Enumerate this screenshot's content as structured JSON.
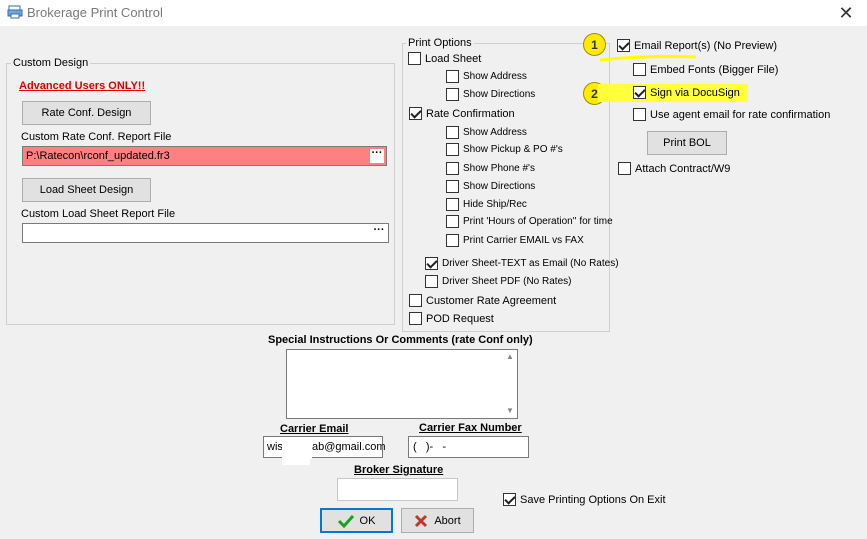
{
  "window": {
    "title": "Brokerage Print Control",
    "close_glyph": "✕"
  },
  "custom_design": {
    "legend": "Custom Design",
    "advanced_label": "Advanced Users ONLY!!",
    "rate_conf_button": "Rate Conf. Design",
    "rate_conf_report_label": "Custom Rate Conf. Report File",
    "rate_conf_report_value": "P:\\Ratecon\\rconf_updated.fr3",
    "load_sheet_button": "Load Sheet Design",
    "load_sheet_report_label": "Custom Load Sheet Report File",
    "load_sheet_report_value": "",
    "ellipsis": "···"
  },
  "print_options": {
    "legend": "Print Options",
    "load_sheet": {
      "label": "Load Sheet",
      "checked": false
    },
    "load_sheet_opts": [
      {
        "label": "Show Address",
        "checked": false
      },
      {
        "label": "Show Directions",
        "checked": false
      }
    ],
    "rate_confirmation": {
      "label": "Rate Confirmation",
      "checked": true
    },
    "rate_conf_opts": [
      {
        "label": "Show Address",
        "checked": false
      },
      {
        "label": "Show Pickup & PO #'s",
        "checked": false
      },
      {
        "label": "Show Phone #'s",
        "checked": false
      },
      {
        "label": "Show Directions",
        "checked": false
      },
      {
        "label": "Hide Ship/Rec",
        "checked": false
      },
      {
        "label": "Print 'Hours of Operation'' for time",
        "checked": false
      },
      {
        "label": "Print Carrier EMAIL vs FAX",
        "checked": false
      }
    ],
    "driver_sheet_text": {
      "label": "Driver Sheet-TEXT as Email (No Rates)",
      "checked": true
    },
    "driver_sheet_pdf": {
      "label": "Driver Sheet PDF (No Rates)",
      "checked": false
    },
    "customer_rate_agreement": {
      "label": "Customer Rate Agreement",
      "checked": false
    },
    "pod_request": {
      "label": "POD Request",
      "checked": false
    }
  },
  "right_options": {
    "badge1": "1",
    "badge2": "2",
    "email_reports": {
      "label": "Email Report(s)  (No Preview)",
      "checked": true
    },
    "embed_fonts": {
      "label": "Embed Fonts (Bigger File)",
      "checked": false
    },
    "sign_docusign": {
      "label": "Sign via DocuSign",
      "checked": true
    },
    "agent_email": {
      "label": "Use agent email for rate confirmation",
      "checked": false
    },
    "print_bol_button": "Print BOL",
    "attach_contract": {
      "label": "Attach Contract/W9",
      "checked": false
    }
  },
  "bottom": {
    "special_instructions_label": "Special Instructions Or Comments (rate Conf only)",
    "special_instructions_value": "",
    "carrier_email_label": "Carrier Email",
    "carrier_email_prefix": "wis",
    "carrier_email_suffix": "ab@gmail.com",
    "carrier_fax_label": "Carrier Fax Number",
    "carrier_fax_value": "(   )-   -",
    "broker_signature_label": "Broker Signature",
    "broker_signature_value": "",
    "save_on_exit": {
      "label": "Save Printing Options On Exit",
      "checked": true
    },
    "ok_button": "OK",
    "abort_button": "Abort"
  },
  "colors": {
    "error_field": "#ff8080",
    "highlight": "#ffff3c",
    "advanced_red": "#e00000",
    "focus_blue": "#0078d7"
  }
}
